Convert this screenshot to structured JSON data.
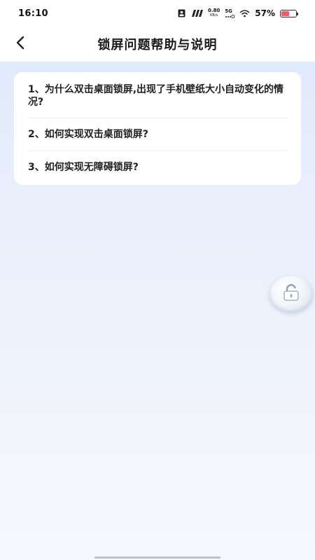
{
  "status_bar": {
    "time": "16:10",
    "net_speed_value": "0.80",
    "net_speed_unit": "KB/s",
    "network_type": "5G",
    "battery_percent": "57%",
    "battery_level": 0.57,
    "icons": [
      "sim-card-icon",
      "signal-bars-icon",
      "5g-signal-icon",
      "wifi-icon",
      "battery-icon"
    ]
  },
  "header": {
    "back_icon": "chevron-left-icon",
    "title": "锁屏问题帮助与说明"
  },
  "faq": {
    "items": [
      {
        "label": "1、为什么双击桌面锁屏,出现了手机壁纸大小自动变化的情况?"
      },
      {
        "label": "2、如何实现双击桌面锁屏?"
      },
      {
        "label": "3、如何实现无障碍锁屏?"
      }
    ]
  },
  "floating_button": {
    "icon": "lock-icon"
  }
}
